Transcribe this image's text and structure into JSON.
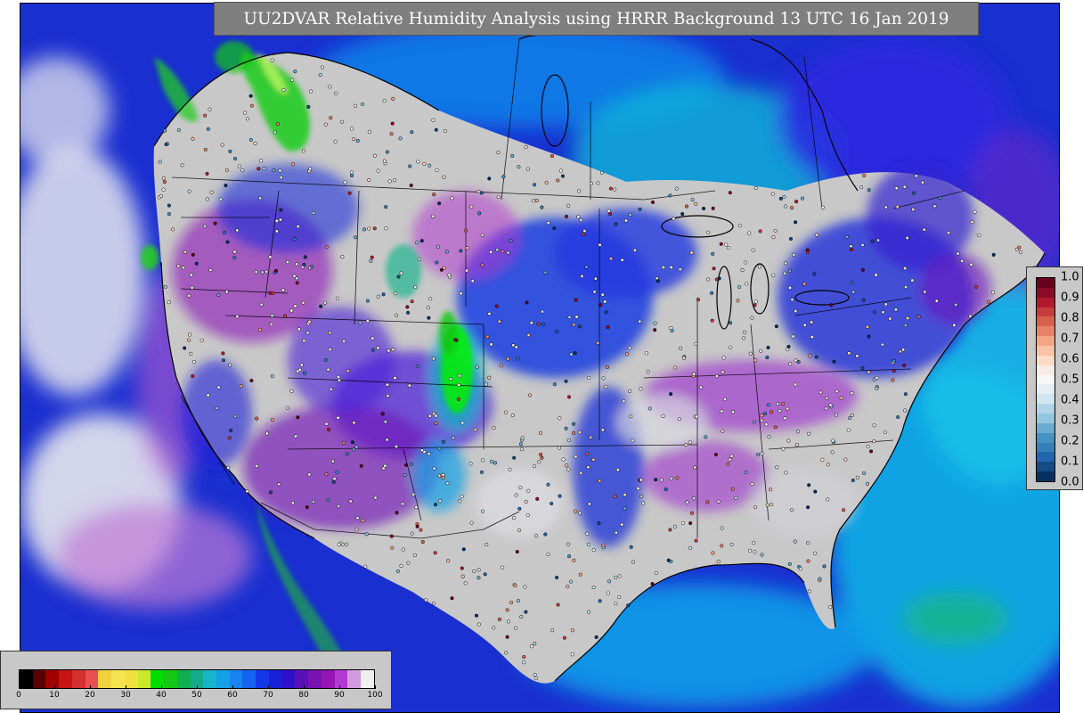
{
  "title": "UU2DVAR Relative Humidity Analysis using HRRR Background 13 UTC 16 Jan 2019",
  "colors": {
    "ocean_deep": "#1a2fd0",
    "ocean_mid": "#0b7fe8",
    "ocean_cyan": "#19c3e6",
    "land_gray": "#c8c8c8",
    "land_white": "#e8e8ea",
    "violet": "#8a12b8",
    "magenta": "#b23ad0",
    "blue_violet": "#4a20d8",
    "green": "#22cc22",
    "bright_green": "#00ee00",
    "teal": "#14b48c",
    "border_line": "#000000"
  },
  "humidity_legend": {
    "ticks": [
      "0",
      "10",
      "20",
      "30",
      "40",
      "50",
      "60",
      "70",
      "80",
      "90",
      "100"
    ],
    "bands": [
      "#000000",
      "#5a0000",
      "#a00000",
      "#c81414",
      "#d43030",
      "#e85050",
      "#f0d240",
      "#f5e450",
      "#f0e040",
      "#c8e828",
      "#00dc00",
      "#14c814",
      "#10b050",
      "#14aa8c",
      "#18b4c8",
      "#14a0e6",
      "#1884f0",
      "#1464f0",
      "#1438e8",
      "#1a20d8",
      "#3010c8",
      "#5a10b8",
      "#7a12b0",
      "#9616b4",
      "#b23ad0",
      "#d49ae0",
      "#f0f0f0"
    ]
  },
  "innovation_legend": {
    "ticks": [
      "1.0",
      "0.9",
      "0.8",
      "0.7",
      "0.6",
      "0.5",
      "0.4",
      "0.3",
      "0.2",
      "0.1",
      "0.0"
    ],
    "bands": [
      "#67001f",
      "#8a0b25",
      "#b2182b",
      "#c43c3c",
      "#d6604d",
      "#e58267",
      "#f4a582",
      "#f8c3a6",
      "#fddbc7",
      "#f7ece5",
      "#f7f7f7",
      "#e7eef3",
      "#d1e5f0",
      "#b0d4e7",
      "#92c5de",
      "#6aabd2",
      "#4393c3",
      "#3580b9",
      "#2166ac",
      "#144c86",
      "#053061"
    ]
  }
}
